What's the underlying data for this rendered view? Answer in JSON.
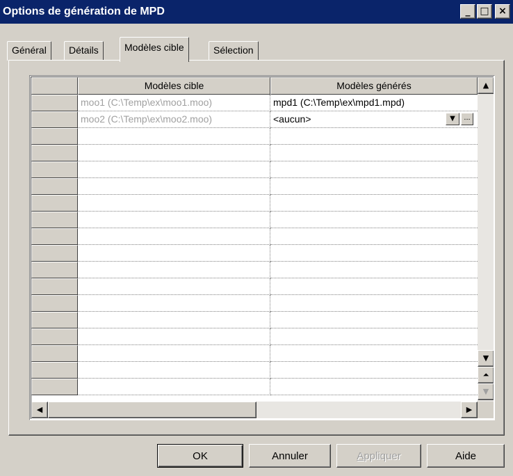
{
  "window": {
    "title": "Options de génération de MPD",
    "minimize_glyph": "_",
    "maximize_glyph": "□",
    "close_glyph": "×"
  },
  "tabs": [
    {
      "label": "Général",
      "active": false
    },
    {
      "label": "Détails",
      "active": false
    },
    {
      "label": "Modèles cible",
      "active": true
    },
    {
      "label": "Sélection",
      "active": false
    }
  ],
  "grid": {
    "columns": [
      "Modèles cible",
      "Modèles générés"
    ],
    "rows": [
      {
        "target": "moo1 (C:\\Temp\\ex\\moo1.moo)",
        "generated": "mpd1 (C:\\Temp\\ex\\mpd1.mpd)"
      },
      {
        "target": "moo2 (C:\\Temp\\ex\\moo2.moo)",
        "generated": "<aucun>"
      }
    ],
    "combo_arrow_glyph": "▼",
    "combo_dots_glyph": "...",
    "empty_row_count": 16
  },
  "buttons": {
    "ok": "OK",
    "cancel": "Annuler",
    "apply": "Appliquer",
    "help": "Aide"
  },
  "scroll": {
    "up": "▲",
    "down": "▼",
    "top": "⏶",
    "left": "◀",
    "right": "▶"
  }
}
